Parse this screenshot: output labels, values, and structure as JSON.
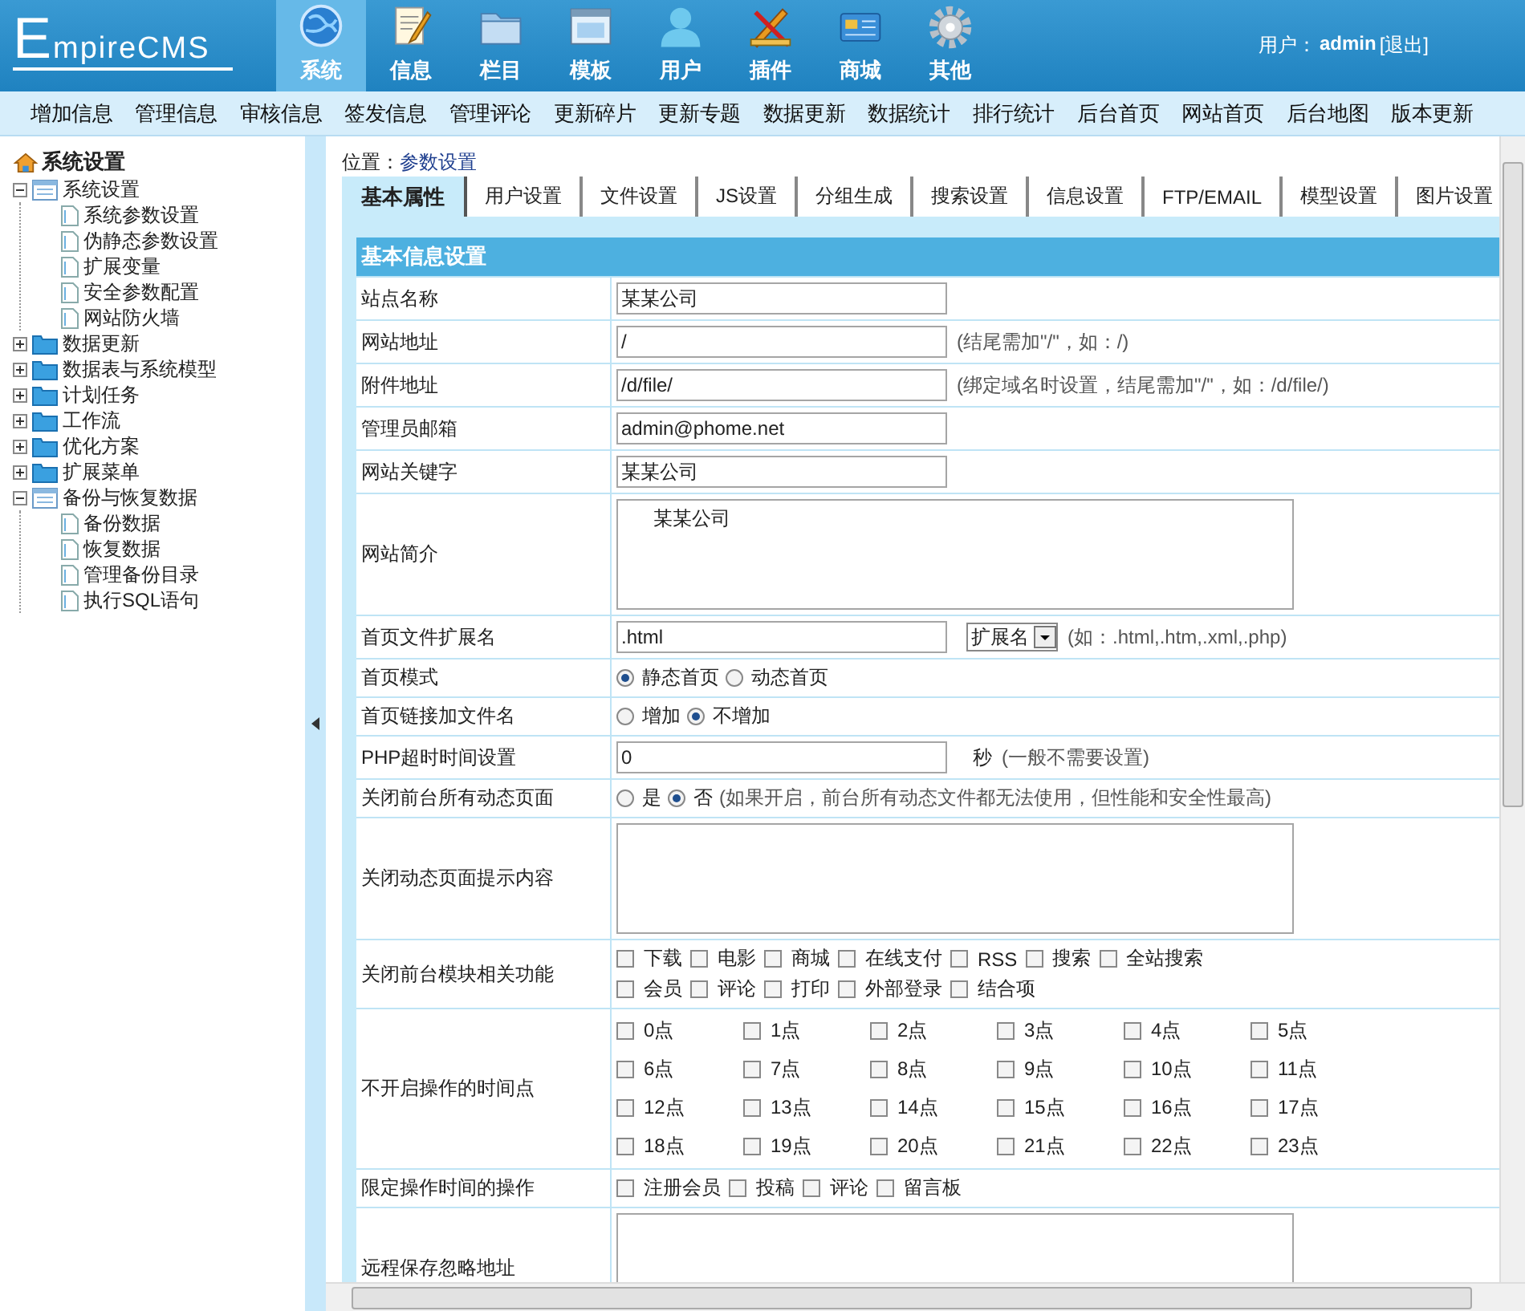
{
  "header": {
    "logo": "EmpireCMS",
    "nav": [
      {
        "label": "系统",
        "selected": true
      },
      {
        "label": "信息",
        "selected": false
      },
      {
        "label": "栏目",
        "selected": false
      },
      {
        "label": "模板",
        "selected": false
      },
      {
        "label": "用户",
        "selected": false
      },
      {
        "label": "插件",
        "selected": false
      },
      {
        "label": "商城",
        "selected": false
      },
      {
        "label": "其他",
        "selected": false
      }
    ],
    "user_label": "用户：",
    "user_name": "admin",
    "logout": "[退出]"
  },
  "menu": [
    "增加信息",
    "管理信息",
    "审核信息",
    "签发信息",
    "管理评论",
    "更新碎片",
    "更新专题",
    "数据更新",
    "数据统计",
    "排行统计",
    "后台首页",
    "网站首页",
    "后台地图",
    "版本更新"
  ],
  "sidebar": {
    "title": "系统设置",
    "items": [
      {
        "label": "系统设置",
        "expanded": true,
        "children": [
          {
            "label": "系统参数设置"
          },
          {
            "label": "伪静态参数设置"
          },
          {
            "label": "扩展变量"
          },
          {
            "label": "安全参数配置"
          },
          {
            "label": "网站防火墙"
          }
        ]
      },
      {
        "label": "数据更新",
        "expanded": false
      },
      {
        "label": "数据表与系统模型",
        "expanded": false
      },
      {
        "label": "计划任务",
        "expanded": false
      },
      {
        "label": "工作流",
        "expanded": false
      },
      {
        "label": "优化方案",
        "expanded": false
      },
      {
        "label": "扩展菜单",
        "expanded": false
      },
      {
        "label": "备份与恢复数据",
        "expanded": true,
        "children": [
          {
            "label": "备份数据"
          },
          {
            "label": "恢复数据"
          },
          {
            "label": "管理备份目录"
          },
          {
            "label": "执行SQL语句"
          }
        ]
      }
    ]
  },
  "location": {
    "label": "位置：",
    "link": "参数设置"
  },
  "tabs": [
    {
      "label": "基本属性",
      "selected": true
    },
    {
      "label": "用户设置",
      "selected": false
    },
    {
      "label": "文件设置",
      "selected": false
    },
    {
      "label": "JS设置",
      "selected": false
    },
    {
      "label": "分组生成",
      "selected": false
    },
    {
      "label": "搜索设置",
      "selected": false
    },
    {
      "label": "信息设置",
      "selected": false
    },
    {
      "label": "FTP/EMAIL",
      "selected": false
    },
    {
      "label": "模型设置",
      "selected": false
    },
    {
      "label": "图片设置",
      "selected": false
    }
  ],
  "table": {
    "title": "基本信息设置",
    "rows": [
      {
        "kind": "text",
        "label": "站点名称",
        "value": "某某公司"
      },
      {
        "kind": "text",
        "label": "网站地址",
        "value": "/",
        "hint": "(结尾需加\"/\"，如：/)"
      },
      {
        "kind": "text",
        "label": "附件地址",
        "value": "/d/file/",
        "hint": "(绑定域名时设置，结尾需加\"/\"，如：/d/file/)"
      },
      {
        "kind": "text",
        "label": "管理员邮箱",
        "value": "admin@phome.net"
      },
      {
        "kind": "text",
        "label": "网站关键字",
        "value": "某某公司"
      },
      {
        "kind": "textarea",
        "label": "网站简介",
        "value": "某某公司"
      },
      {
        "kind": "select",
        "label": "首页文件扩展名",
        "value": ".html",
        "select": "扩展名",
        "hint": "(如：.html,.htm,.xml,.php)"
      },
      {
        "kind": "radio",
        "label": "首页模式",
        "options": [
          {
            "label": "静态首页",
            "selected": true
          },
          {
            "label": "动态首页",
            "selected": false
          }
        ]
      },
      {
        "kind": "radio",
        "label": "首页链接加文件名",
        "options": [
          {
            "label": "增加",
            "selected": false
          },
          {
            "label": "不增加",
            "selected": true
          }
        ]
      },
      {
        "kind": "text",
        "label": "PHP超时时间设置",
        "value": "0",
        "unit": "秒",
        "hint": "(一般不需要设置)"
      },
      {
        "kind": "radio",
        "label": "关闭前台所有动态页面",
        "options": [
          {
            "label": "是",
            "selected": false
          },
          {
            "label": "否",
            "selected": true
          }
        ],
        "hint": "(如果开启，前台所有动态文件都无法使用，但性能和安全性最高)"
      },
      {
        "kind": "textarea",
        "label": "关闭动态页面提示内容"
      },
      {
        "kind": "checks",
        "label": "关闭前台模块相关功能",
        "lines": [
          [
            {
              "label": "下载",
              "checked": false
            },
            {
              "label": "电影",
              "checked": false
            },
            {
              "label": "商城",
              "checked": false
            },
            {
              "label": "在线支付",
              "checked": false
            },
            {
              "label": "RSS",
              "checked": false
            },
            {
              "label": "搜索",
              "checked": false
            },
            {
              "label": "全站搜索",
              "checked": false
            }
          ],
          [
            {
              "label": "会员",
              "checked": false
            },
            {
              "label": "评论",
              "checked": false
            },
            {
              "label": "打印",
              "checked": false
            },
            {
              "label": "外部登录",
              "checked": false
            },
            {
              "label": "结合项",
              "checked": false
            }
          ]
        ]
      },
      {
        "kind": "grid",
        "label": "不开启操作的时间点",
        "options": [
          {
            "label": "0点",
            "checked": false
          },
          {
            "label": "1点",
            "checked": false
          },
          {
            "label": "2点",
            "checked": false
          },
          {
            "label": "3点",
            "checked": false
          },
          {
            "label": "4点",
            "checked": false
          },
          {
            "label": "5点",
            "checked": false
          },
          {
            "label": "6点",
            "checked": false
          },
          {
            "label": "7点",
            "checked": false
          },
          {
            "label": "8点",
            "checked": false
          },
          {
            "label": "9点",
            "checked": false
          },
          {
            "label": "10点",
            "checked": false
          },
          {
            "label": "11点",
            "checked": false
          },
          {
            "label": "12点",
            "checked": false
          },
          {
            "label": "13点",
            "checked": false
          },
          {
            "label": "14点",
            "checked": false
          },
          {
            "label": "15点",
            "checked": false
          },
          {
            "label": "16点",
            "checked": false
          },
          {
            "label": "17点",
            "checked": false
          },
          {
            "label": "18点",
            "checked": false
          },
          {
            "label": "19点",
            "checked": false
          },
          {
            "label": "20点",
            "checked": false
          },
          {
            "label": "21点",
            "checked": false
          },
          {
            "label": "22点",
            "checked": false
          },
          {
            "label": "23点",
            "checked": false
          }
        ]
      },
      {
        "kind": "checks",
        "label": "限定操作时间的操作",
        "lines": [
          [
            {
              "label": "注册会员",
              "checked": false
            },
            {
              "label": "投稿",
              "checked": false
            },
            {
              "label": "评论",
              "checked": false
            },
            {
              "label": "留言板",
              "checked": false
            }
          ]
        ]
      },
      {
        "kind": "textarea",
        "label": "远程保存忽略地址"
      }
    ]
  }
}
